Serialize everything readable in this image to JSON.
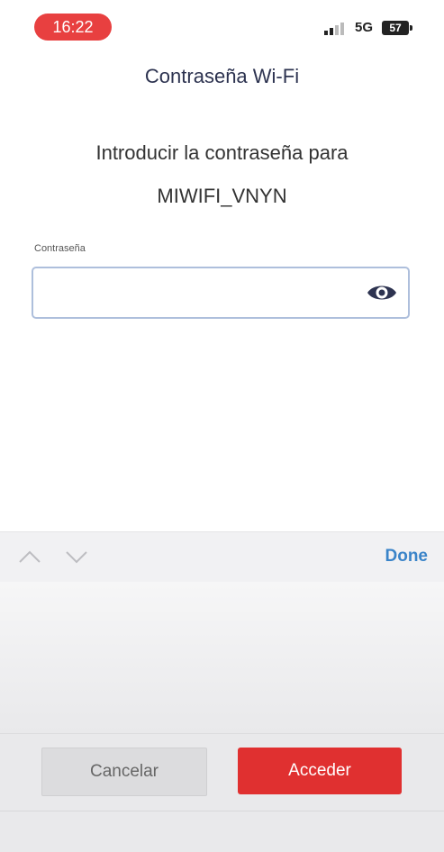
{
  "status_bar": {
    "time": "16:22",
    "network": "5G",
    "battery": "57",
    "time_pill_color": "#e84040"
  },
  "dialog": {
    "title": "Contraseña Wi-Fi",
    "prompt": "Introducir la contraseña para",
    "ssid": "MIWIFI_VNYN"
  },
  "password_field": {
    "label": "Contraseña",
    "value": "",
    "placeholder": ""
  },
  "keyboard_toolbar": {
    "done_label": "Done"
  },
  "actions": {
    "cancel_label": "Cancelar",
    "accept_label": "Acceder",
    "accent_color": "#e03030"
  },
  "icons": [
    "signal-icon",
    "battery-icon",
    "eye-icon",
    "chevron-up-icon",
    "chevron-down-icon"
  ]
}
